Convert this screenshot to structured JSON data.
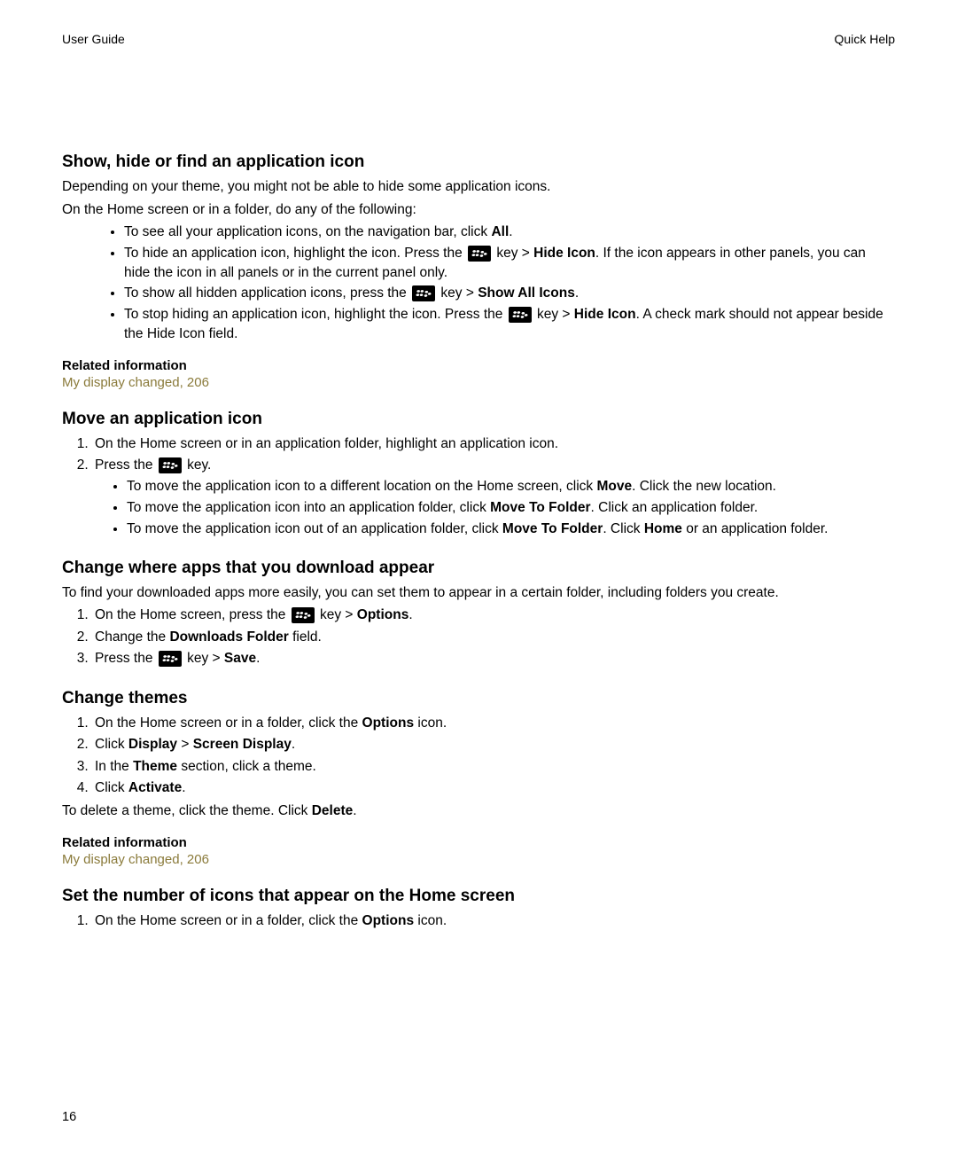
{
  "header": {
    "left": "User Guide",
    "right": "Quick Help"
  },
  "page_number": "16",
  "links": {
    "display_changed": "My display changed, 206"
  },
  "related_info": "Related information",
  "ui": {
    "all": "All",
    "hide_icon": "Hide Icon",
    "show_all": "Show All Icons",
    "move": "Move",
    "move_to_folder": "Move To Folder",
    "home": "Home",
    "options": "Options",
    "downloads_folder": "Downloads Folder",
    "save": "Save",
    "display": "Display",
    "screen_display": "Screen Display",
    "theme": "Theme",
    "activate": "Activate",
    "delete": "Delete"
  },
  "sec1": {
    "title": "Show, hide or find an application icon",
    "p1": "Depending on your theme, you might not be able to hide some application icons.",
    "p2": "On the Home screen or in a folder, do any of the following:",
    "b1a": "To see all your application icons, on the navigation bar, click ",
    "b1b": ".",
    "b2a": "To hide an application icon, highlight the icon. Press the ",
    "b2b": " key > ",
    "b2c": ". If the icon appears in other panels, you can hide the icon in all panels or in the current panel only.",
    "b3a": "To show all hidden application icons, press the ",
    "b3b": " key > ",
    "b3c": ".",
    "b4a": "To stop hiding an application icon, highlight the icon. Press the ",
    "b4b": " key > ",
    "b4c": ". A check mark should not appear beside the Hide Icon field."
  },
  "sec2": {
    "title": "Move an application icon",
    "s1": "On the Home screen or in an application folder, highlight an application icon.",
    "s2a": "Press the ",
    "s2b": " key.",
    "b1a": "To move the application icon to a different location on the Home screen, click ",
    "b1b": ". Click the new location.",
    "b2a": "To move the application icon into an application folder, click ",
    "b2b": ". Click an application folder.",
    "b3a": "To move the application icon out of an application folder, click ",
    "b3b": ". Click ",
    "b3c": " or an application folder."
  },
  "sec3": {
    "title": "Change where apps that you download appear",
    "p1": "To find your downloaded apps more easily, you can set them to appear in a certain folder, including folders you create.",
    "s1a": "On the Home screen, press the ",
    "s1b": " key > ",
    "s1c": ".",
    "s2a": "Change the ",
    "s2b": " field.",
    "s3a": "Press the ",
    "s3b": " key > ",
    "s3c": "."
  },
  "sec4": {
    "title": "Change themes",
    "s1a": "On the Home screen or in a folder, click the ",
    "s1b": " icon.",
    "s2a": "Click ",
    "s2b": " > ",
    "s2c": ".",
    "s3a": "In the ",
    "s3b": " section, click a theme.",
    "s4a": "Click ",
    "s4b": ".",
    "p1a": "To delete a theme, click the theme. Click ",
    "p1b": "."
  },
  "sec5": {
    "title": "Set the number of icons that appear on the Home screen",
    "s1a": "On the Home screen or in a folder, click the ",
    "s1b": " icon."
  }
}
